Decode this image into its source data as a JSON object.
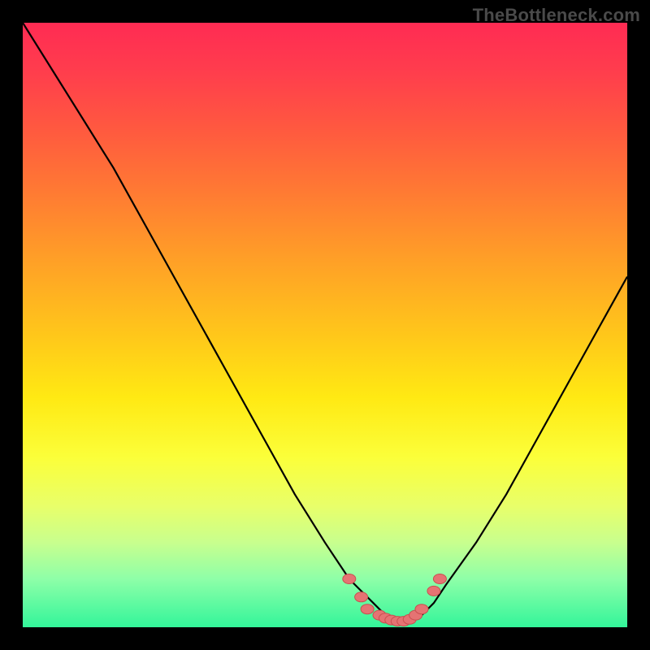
{
  "watermark": "TheBottleneck.com",
  "colors": {
    "curve_stroke": "#000000",
    "marker_fill": "#e57373",
    "marker_stroke": "#c94f4f",
    "background": "#000000"
  },
  "chart_data": {
    "type": "line",
    "title": "",
    "xlabel": "",
    "ylabel": "",
    "xlim": [
      0,
      100
    ],
    "ylim": [
      0,
      100
    ],
    "series": [
      {
        "name": "bottleneck-curve",
        "x": [
          0,
          5,
          10,
          15,
          20,
          25,
          30,
          35,
          40,
          45,
          50,
          54,
          56,
          58,
          60,
          62,
          64,
          66,
          68,
          70,
          75,
          80,
          85,
          90,
          95,
          100
        ],
        "y": [
          100,
          92,
          84,
          76,
          67,
          58,
          49,
          40,
          31,
          22,
          14,
          8,
          6,
          4,
          2,
          1,
          1,
          2,
          4,
          7,
          14,
          22,
          31,
          40,
          49,
          58
        ]
      }
    ],
    "markers": [
      {
        "x": 54,
        "y": 8
      },
      {
        "x": 56,
        "y": 5
      },
      {
        "x": 57,
        "y": 3
      },
      {
        "x": 59,
        "y": 2
      },
      {
        "x": 60,
        "y": 1.5
      },
      {
        "x": 61,
        "y": 1.2
      },
      {
        "x": 62,
        "y": 1
      },
      {
        "x": 63,
        "y": 1
      },
      {
        "x": 64,
        "y": 1.3
      },
      {
        "x": 65,
        "y": 2
      },
      {
        "x": 66,
        "y": 3
      },
      {
        "x": 68,
        "y": 6
      },
      {
        "x": 69,
        "y": 8
      }
    ]
  }
}
